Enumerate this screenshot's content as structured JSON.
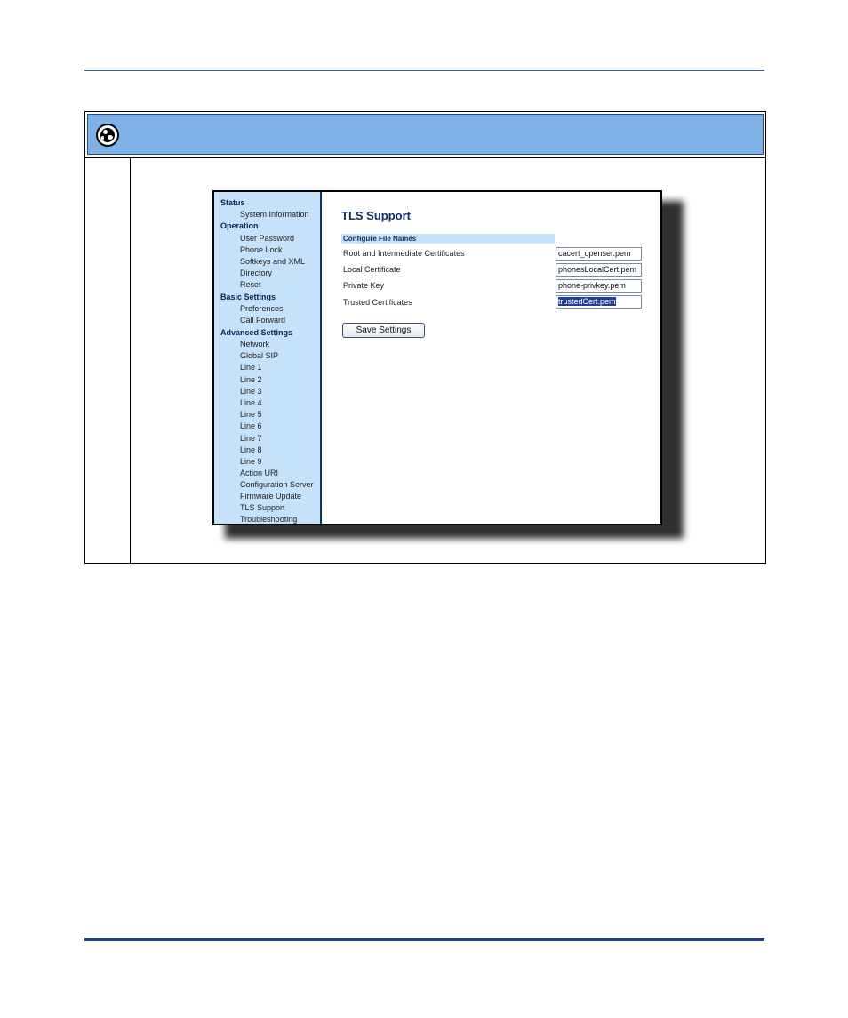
{
  "sidebar": {
    "items": [
      {
        "label": "Status",
        "type": "section"
      },
      {
        "label": "System Information",
        "type": "item"
      },
      {
        "label": "Operation",
        "type": "section"
      },
      {
        "label": "User Password",
        "type": "item"
      },
      {
        "label": "Phone Lock",
        "type": "item"
      },
      {
        "label": "Softkeys and XML",
        "type": "item"
      },
      {
        "label": "Directory",
        "type": "item"
      },
      {
        "label": "Reset",
        "type": "item"
      },
      {
        "label": "Basic Settings",
        "type": "section"
      },
      {
        "label": "Preferences",
        "type": "item"
      },
      {
        "label": "Call Forward",
        "type": "item"
      },
      {
        "label": "Advanced Settings",
        "type": "section"
      },
      {
        "label": "Network",
        "type": "item"
      },
      {
        "label": "Global SIP",
        "type": "item"
      },
      {
        "label": "Line 1",
        "type": "item"
      },
      {
        "label": "Line 2",
        "type": "item"
      },
      {
        "label": "Line 3",
        "type": "item"
      },
      {
        "label": "Line 4",
        "type": "item"
      },
      {
        "label": "Line 5",
        "type": "item"
      },
      {
        "label": "Line 6",
        "type": "item"
      },
      {
        "label": "Line 7",
        "type": "item"
      },
      {
        "label": "Line 8",
        "type": "item"
      },
      {
        "label": "Line 9",
        "type": "item"
      },
      {
        "label": "Action URI",
        "type": "item"
      },
      {
        "label": "Configuration Server",
        "type": "item"
      },
      {
        "label": "Firmware Update",
        "type": "item"
      },
      {
        "label": "TLS Support",
        "type": "item"
      },
      {
        "label": "Troubleshooting",
        "type": "item"
      }
    ]
  },
  "main": {
    "title": "TLS Support",
    "section_label": "Configure File Names",
    "fields": [
      {
        "label": "Root and Intermediate Certificates",
        "value": "cacert_openser.pem"
      },
      {
        "label": "Local Certificate",
        "value": "phonesLocalCert.pem"
      },
      {
        "label": "Private Key",
        "value": "phone-privkey.pem"
      },
      {
        "label": "Trusted Certificates",
        "value": "trustedCert.pem"
      }
    ],
    "save_label": "Save Settings"
  },
  "colors": {
    "header_bar": "#7eb1e8",
    "sidebar_bg": "#c6e2fb",
    "title_text": "#0d2a6b",
    "selection": "#1c3f94"
  },
  "icons": {
    "header": "globe-icon"
  }
}
